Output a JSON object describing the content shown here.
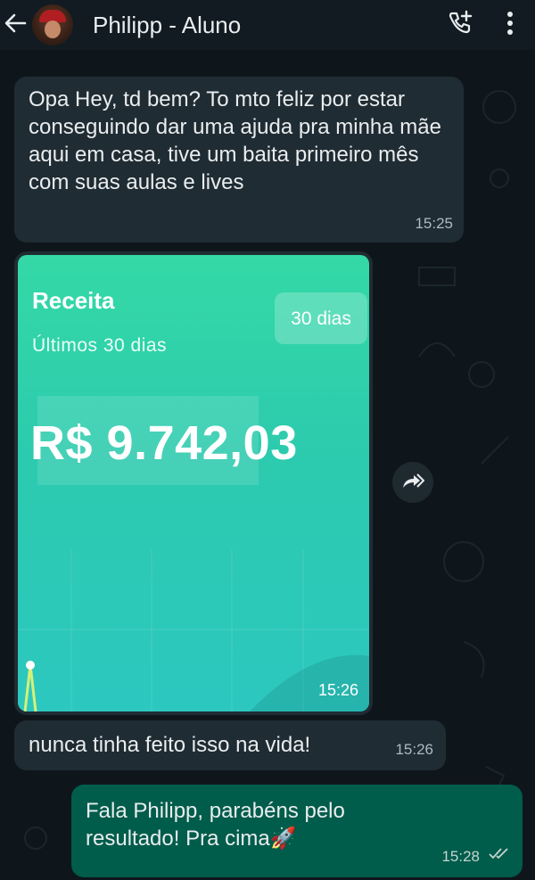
{
  "header": {
    "contact_name": "Philipp - Aluno",
    "back_icon": "arrow-left-icon",
    "call_icon": "add-call-icon",
    "menu_icon": "more-vertical-icon"
  },
  "messages": [
    {
      "direction": "incoming",
      "text": "Opa Hey, td bem? To mto feliz por estar conseguindo dar uma ajuda pra minha mãe aqui em casa, tive um baita primeiro mês com suas aulas e lives",
      "time": "15:25"
    },
    {
      "direction": "incoming",
      "type": "image",
      "time": "15:26",
      "card": {
        "title": "Receita",
        "subtitle": "Últimos 30 dias",
        "period_button": "30 dias",
        "value": "R$ 9.742,03"
      }
    },
    {
      "direction": "incoming",
      "text": "nunca tinha feito isso na vida!",
      "time": "15:26"
    },
    {
      "direction": "outgoing",
      "text": "Fala Philipp, parabéns pelo resultado! Pra cima🚀",
      "time": "15:28",
      "status_icon": "double-check-icon"
    }
  ],
  "colors": {
    "background": "#0b141a",
    "incoming_bubble": "#202c33",
    "outgoing_bubble": "#005c4b",
    "card_accent": "#2ccaae"
  }
}
